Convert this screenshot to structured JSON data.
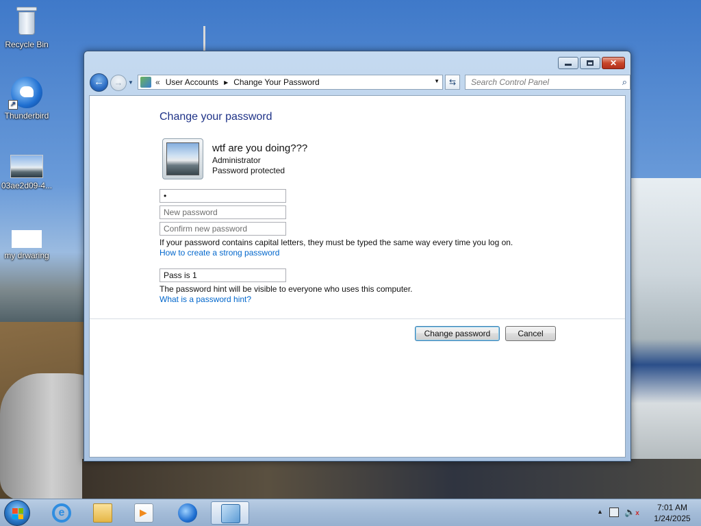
{
  "desktop": {
    "icons": [
      {
        "label": "Recycle Bin"
      },
      {
        "label": "Thunderbird"
      },
      {
        "label": "03ae2d09-4..."
      },
      {
        "label": "my drwaring"
      }
    ]
  },
  "window": {
    "address": {
      "crumbs": [
        "User Accounts",
        "Change Your Password"
      ],
      "chevron": "«"
    },
    "search": {
      "placeholder": "Search Control Panel"
    },
    "content": {
      "heading": "Change your password",
      "user": {
        "name": "wtf are you doing???",
        "role": "Administrator",
        "status": "Password protected"
      },
      "fields": {
        "current_password_value": "•",
        "new_password_placeholder": "New password",
        "confirm_password_placeholder": "Confirm new password",
        "hint_value": "Pass is 1"
      },
      "caps_note": "If your password contains capital letters, they must be typed the same way every time you log on.",
      "strong_password_link": "How to create a strong password",
      "hint_note": "The password hint will be visible to everyone who uses this computer.",
      "hint_link": "What is a password hint?",
      "buttons": {
        "change": "Change password",
        "cancel": "Cancel"
      }
    }
  },
  "taskbar": {
    "apps": [
      "internet-explorer-icon",
      "folder-icon",
      "media-player-icon",
      "thunderbird-icon",
      "control-panel-icon"
    ],
    "clock": {
      "time": "7:01 AM",
      "date": "1/24/2025"
    }
  }
}
